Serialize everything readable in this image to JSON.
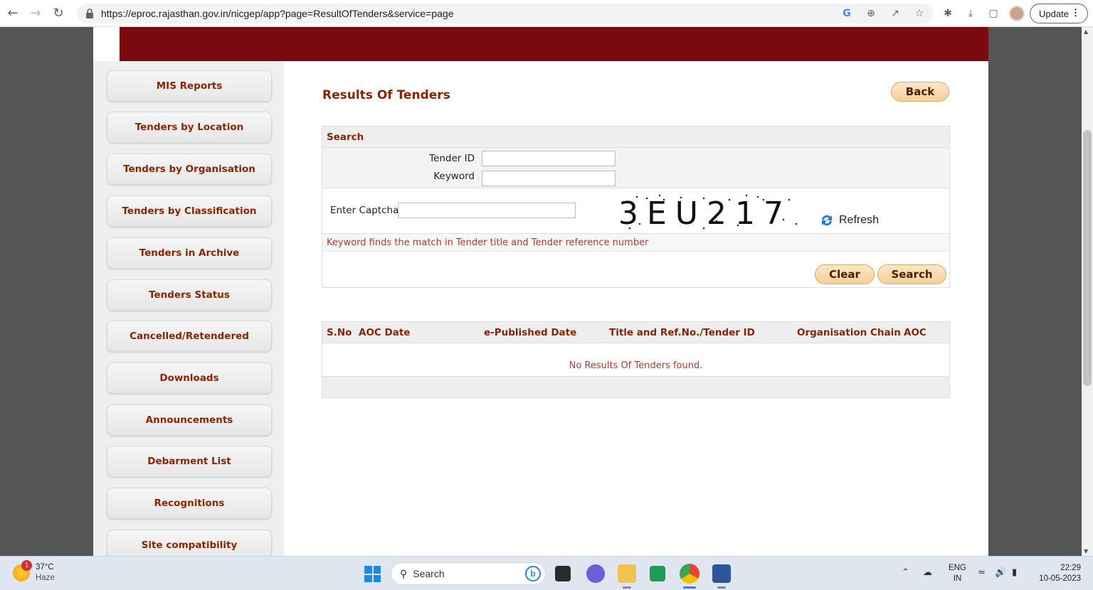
{
  "browser": {
    "url": "https://eproc.rajasthan.gov.in/nicgep/app?page=ResultOfTenders&service=page",
    "update_label": "Update"
  },
  "sidebar": {
    "items": [
      {
        "label": "MIS Reports"
      },
      {
        "label": "Tenders by Location"
      },
      {
        "label": "Tenders by Organisation"
      },
      {
        "label": "Tenders by Classification"
      },
      {
        "label": "Tenders in Archive"
      },
      {
        "label": "Tenders Status"
      },
      {
        "label": "Cancelled/Retendered"
      },
      {
        "label": "Downloads"
      },
      {
        "label": "Announcements"
      },
      {
        "label": "Debarment List"
      },
      {
        "label": "Recognitions"
      },
      {
        "label": "Site compatibility"
      }
    ]
  },
  "main": {
    "title": "Results Of Tenders",
    "back_label": "Back",
    "search": {
      "heading": "Search",
      "tender_id_label": "Tender ID",
      "tender_id_value": "",
      "keyword_label": "Keyword",
      "keyword_value": "",
      "captcha_label": "Enter Captcha",
      "captcha_value": "",
      "captcha_text": "3EU217",
      "refresh_label": "Refresh",
      "note": "Keyword finds the match in Tender title and Tender reference number",
      "clear_label": "Clear",
      "search_label": "Search"
    },
    "results": {
      "columns": [
        "S.No",
        "AOC Date",
        "e-Published Date",
        "Title and Ref.No./Tender ID",
        "Organisation Chain",
        "AOC"
      ],
      "empty_message": "No Results Of Tenders found."
    }
  },
  "taskbar": {
    "weather_temp": "37°C",
    "weather_desc": "Haze",
    "weather_badge": "1",
    "search_placeholder": "Search",
    "lang_top": "ENG",
    "lang_bottom": "IN",
    "time": "22:29",
    "date": "10-05-2023"
  },
  "colors": {
    "banner": "#7a0a0e",
    "link_text": "#8b2500",
    "note_text": "#b03a2e",
    "button_fill": "#f6cf9a"
  }
}
